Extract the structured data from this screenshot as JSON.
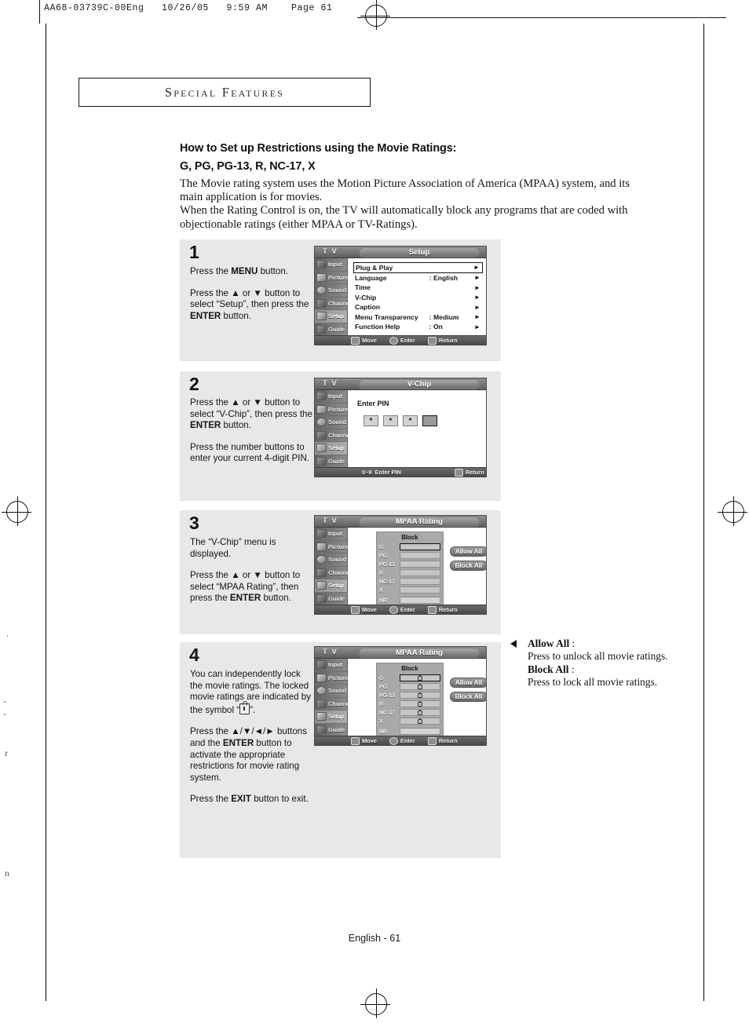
{
  "page": {
    "file_header": "AA68-03739C-00Eng   10/26/05   9:59 AM    Page 61",
    "section_banner": "Special Features",
    "footer": "English - 61",
    "bleed_left": [
      ".",
      "-",
      "-",
      "r",
      "n"
    ]
  },
  "headings": {
    "line1": "How to Set up Restrictions using the Movie Ratings:",
    "line2": "G, PG, PG-13, R, NC-17, X"
  },
  "intro": {
    "p1": "The Movie rating system uses the Motion Picture Association of America (MPAA) system, and its main application is for movies.",
    "p2": "When the Rating Control is on, the TV will automatically block any programs that are coded with objectionable ratings (either MPAA or TV-Ratings)."
  },
  "steps": [
    {
      "number": "1",
      "paragraphs": [
        "Press the MENU button.",
        "Press the ▲ or ▼ button to select “Setup”, then press the ENTER button."
      ]
    },
    {
      "number": "2",
      "paragraphs": [
        "Press the ▲ or ▼ button to select “V-Chip”, then press the ENTER button.",
        "Press the number buttons to enter your current 4-digit PIN."
      ]
    },
    {
      "number": "3",
      "paragraphs": [
        "The “V-Chip” menu is displayed.",
        "Press the ▲ or ▼ button to select “MPAA Rating”, then press the ENTER button."
      ]
    },
    {
      "number": "4",
      "paragraphs": [
        "You can independently lock the movie ratings. The locked movie ratings are indicated by the symbol “  ”.",
        "Press the ▲/▼/◄/► buttons and the ENTER button to activate the appropriate restrictions for movie rating system.",
        "Press the EXIT button to exit."
      ]
    }
  ],
  "osd": {
    "tv_label": "T V",
    "sidebar": [
      {
        "label": "Input",
        "icon": "input-icon",
        "active": false
      },
      {
        "label": "Picture",
        "icon": "picture-icon",
        "active": false
      },
      {
        "label": "Sound",
        "icon": "sound-icon",
        "active": false
      },
      {
        "label": "Channel",
        "icon": "channel-icon",
        "active": false
      },
      {
        "label": "Setup",
        "icon": "setup-icon",
        "active": true
      },
      {
        "label": "Guide",
        "icon": "guide-icon",
        "active": false
      }
    ],
    "status_bar": {
      "move": "Move",
      "enter": "Enter",
      "return": "Return",
      "pin_range": "0~9",
      "pin_hint": "Enter PIN"
    },
    "setup_screen": {
      "title": "Setup",
      "rows": [
        {
          "name": "Plug & Play",
          "colon": "",
          "value": "",
          "arrow": "►",
          "selected": true
        },
        {
          "name": "Language",
          "colon": ":",
          "value": "English",
          "arrow": "►",
          "selected": false
        },
        {
          "name": "Time",
          "colon": "",
          "value": "",
          "arrow": "►",
          "selected": false
        },
        {
          "name": "V-Chip",
          "colon": "",
          "value": "",
          "arrow": "►",
          "selected": false
        },
        {
          "name": "Caption",
          "colon": "",
          "value": "",
          "arrow": "►",
          "selected": false
        },
        {
          "name": "Menu Transparency",
          "colon": ":",
          "value": "Medium",
          "arrow": "►",
          "selected": false
        },
        {
          "name": "Function Help",
          "colon": ":",
          "value": "On",
          "arrow": "►",
          "selected": false
        }
      ]
    },
    "vchip_screen": {
      "title": "V-Chip",
      "enter_pin_label": "Enter PIN",
      "pin_boxes": [
        "*",
        "*",
        "*",
        ""
      ]
    },
    "mpaa_screen": {
      "title": "MPAA Rating",
      "block_header": "Block",
      "ratings": [
        "G",
        "PG",
        "PG-13",
        "R",
        "NC-17",
        "X"
      ],
      "nr_label": "NR",
      "allow_all": "Allow All",
      "block_all": "Block All",
      "step3_locks": [
        false,
        false,
        false,
        false,
        false,
        false
      ],
      "step4_locks": [
        true,
        true,
        true,
        true,
        true,
        true
      ],
      "nr_locked": false,
      "selected_index": 0
    }
  },
  "side_note": {
    "allow_all_term": "Allow All",
    "allow_all_desc": "Press to unlock all movie ratings.",
    "block_all_term": "Block All",
    "block_all_desc": "Press to lock all movie ratings."
  }
}
